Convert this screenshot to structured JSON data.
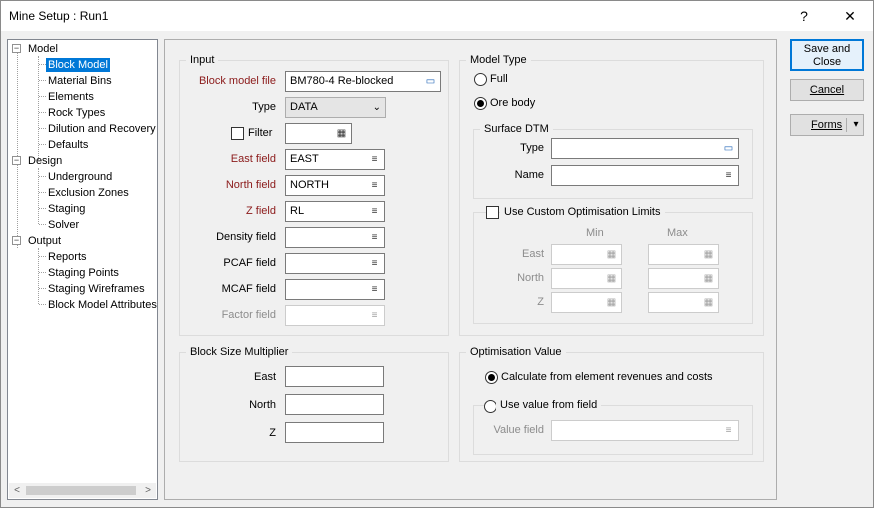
{
  "window": {
    "title": "Mine Setup : Run1",
    "help_icon": "?",
    "close_icon": "✕"
  },
  "tree": {
    "model": "Model",
    "block_model": "Block Model",
    "material_bins": "Material Bins",
    "elements": "Elements",
    "rock_types": "Rock Types",
    "dilution_and_recovery": "Dilution and Recovery",
    "defaults": "Defaults",
    "design": "Design",
    "underground": "Underground",
    "exclusion_zones": "Exclusion Zones",
    "staging": "Staging",
    "solver": "Solver",
    "output": "Output",
    "reports": "Reports",
    "staging_points": "Staging Points",
    "staging_wireframes": "Staging Wireframes",
    "block_model_attributes": "Block Model Attributes",
    "expander": "−"
  },
  "input": {
    "title": "Input",
    "block_model_file_label": "Block model file",
    "block_model_file_value": "BM780-4 Re-blocked",
    "type_label": "Type",
    "type_value": "DATA",
    "filter_label": "Filter",
    "filter_value": "",
    "east_field_label": "East field",
    "east_field_value": "EAST",
    "north_field_label": "North field",
    "north_field_value": "NORTH",
    "z_field_label": "Z field",
    "z_field_value": "RL",
    "density_field_label": "Density field",
    "density_field_value": "",
    "pcaf_field_label": "PCAF field",
    "pcaf_field_value": "",
    "mcaf_field_label": "MCAF field",
    "mcaf_field_value": "",
    "factor_field_label": "Factor field",
    "factor_field_value": ""
  },
  "block_size": {
    "title": "Block Size Multiplier",
    "east_label": "East",
    "east_value": "",
    "north_label": "North",
    "north_value": "",
    "z_label": "Z",
    "z_value": ""
  },
  "model_type": {
    "title": "Model Type",
    "full_label": "Full",
    "ore_body_label": "Ore body",
    "selected": "Ore body"
  },
  "surface_dtm": {
    "title": "Surface DTM",
    "type_label": "Type",
    "type_value": "",
    "name_label": "Name",
    "name_value": ""
  },
  "custom_limits": {
    "checkbox_label": "Use Custom Optimisation Limits",
    "checked": false,
    "min_header": "Min",
    "max_header": "Max",
    "east_label": "East",
    "north_label": "North",
    "z_label": "Z"
  },
  "optimisation_value": {
    "title": "Optimisation Value",
    "calc_label": "Calculate from element revenues and costs",
    "use_field_label": "Use value from field",
    "selected": "Calculate from element revenues and costs",
    "value_field_label": "Value field",
    "value_field_value": ""
  },
  "buttons": {
    "save_close": "Save and Close",
    "cancel": "Cancel",
    "forms": "Forms",
    "forms_arrow": "▾"
  },
  "icons": {
    "list": "≡",
    "browse": "▭",
    "calc": "▦",
    "dropdown": "⌄",
    "scroll_left": "<",
    "scroll_right": ">"
  }
}
